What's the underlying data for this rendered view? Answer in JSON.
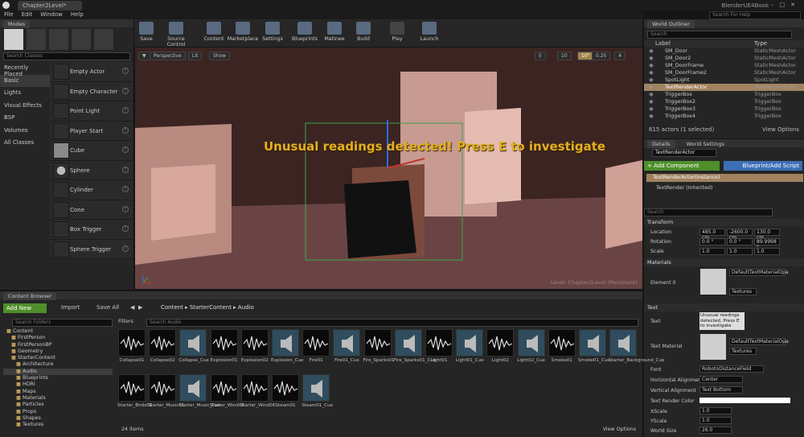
{
  "window": {
    "tab_title": "Chapter2Level*",
    "project_name": "BlenderUE4Book",
    "search_help_placeholder": "Search For Help"
  },
  "menu": [
    "File",
    "Edit",
    "Window",
    "Help"
  ],
  "modes": {
    "title": "Modes",
    "search_placeholder": "Search Classes",
    "categories": [
      "Recently Placed",
      "Basic",
      "Lights",
      "Visual Effects",
      "BSP",
      "Volumes",
      "All Classes"
    ],
    "selected_category": "Basic",
    "items": [
      "Empty Actor",
      "Empty Character",
      "Point Light",
      "Player Start",
      "Cube",
      "Sphere",
      "Cylinder",
      "Cone",
      "Box Trigger",
      "Sphere Trigger"
    ]
  },
  "toolbar": [
    "Save",
    "Source Control",
    "Content",
    "Marketplace",
    "Settings",
    "Blueprints",
    "Matinee",
    "Build",
    "Play",
    "Launch"
  ],
  "viewport": {
    "perspective": "Perspective",
    "lit": "Lit",
    "show": "Show",
    "grid_snap": "10",
    "rot_snap": "10°",
    "scale_snap": "0.25",
    "cam_speed": "4",
    "num5": "5",
    "text_render": "Unusual readings detected! Press E to investigate",
    "level_label": "Level:  Chapter2Level (Persistent)"
  },
  "outliner": {
    "title": "World Outliner",
    "search_placeholder": "Search",
    "col_label": "Label",
    "col_type": "Type",
    "rows": [
      {
        "label": "SM_Door",
        "type": "StaticMeshActor"
      },
      {
        "label": "SM_Door2",
        "type": "StaticMeshActor"
      },
      {
        "label": "SM_DoorFrame",
        "type": "StaticMeshActor"
      },
      {
        "label": "SM_DoorFrame2",
        "type": "StaticMeshActor"
      },
      {
        "label": "SpotLight",
        "type": "SpotLight"
      },
      {
        "label": "TextRenderActor",
        "type": "TextRenderActor"
      },
      {
        "label": "TriggerBox",
        "type": "TriggerBox"
      },
      {
        "label": "TriggerBox2",
        "type": "TriggerBox"
      },
      {
        "label": "TriggerBox3",
        "type": "TriggerBox"
      },
      {
        "label": "TriggerBox4",
        "type": "TriggerBox"
      }
    ],
    "selected_row": 5,
    "status": "615 actors (1 selected)",
    "view_options": "View Options"
  },
  "details": {
    "tab_details": "Details",
    "tab_world": "World Settings",
    "name": "TextRenderActor",
    "add_component": "+ Add Component",
    "blueprint_script": "Blueprint/Add Script",
    "instance": "TextRenderActor(Instance)",
    "inherited": "TextRender (Inherited)",
    "search_placeholder": "Search",
    "transform_header": "Transform",
    "location_label": "Location",
    "location": [
      "485.0 cm",
      "-2600.0 cm",
      "130.0 cm"
    ],
    "rotation_label": "Rotation",
    "rotation": [
      "0.0 °",
      "0.0 °",
      "89.9998 °"
    ],
    "scale_label": "Scale",
    "scale": [
      "1.0",
      "1.0",
      "1.0"
    ],
    "materials_header": "Materials",
    "element0": "Element 0",
    "material_name": "DefaultTextMaterialOpa",
    "textures_btn": "Textures",
    "text_header": "Text",
    "text_label": "Text",
    "text_value": "Unusual readings detected. Press E to investigate",
    "text_material_label": "Text Material",
    "text_material": "DefaultTextMaterialOpa",
    "text_material_btn": "Textures",
    "font_label": "Font",
    "font_value": "RobotoDistanceField",
    "h_align_label": "Horizontal Alignment",
    "h_align": "Center",
    "v_align_label": "Vertical Alignment",
    "v_align": "Text Bottom",
    "color_label": "Text Render Color",
    "xscale_label": "XScale",
    "xscale": "1.0",
    "yscale_label": "YScale",
    "yscale": "1.0",
    "world_size_label": "World Size",
    "world_size": "26.0"
  },
  "content_browser": {
    "title": "Content Browser",
    "add_new": "Add New",
    "import": "Import",
    "save_all": "Save All",
    "path": [
      "Content",
      "StarterContent",
      "Audio"
    ],
    "search_folders": "Search Folders",
    "filters": "Filters",
    "search_audio": "Search Audio",
    "folders": [
      {
        "name": "Content",
        "level": 0
      },
      {
        "name": "FirstPerson",
        "level": 1
      },
      {
        "name": "FirstPersonBP",
        "level": 1
      },
      {
        "name": "Geometry",
        "level": 1
      },
      {
        "name": "StarterContent",
        "level": 1
      },
      {
        "name": "Architecture",
        "level": 2
      },
      {
        "name": "Audio",
        "level": 2
      },
      {
        "name": "Blueprints",
        "level": 2
      },
      {
        "name": "HDRI",
        "level": 2
      },
      {
        "name": "Maps",
        "level": 2
      },
      {
        "name": "Materials",
        "level": 2
      },
      {
        "name": "Particles",
        "level": 2
      },
      {
        "name": "Props",
        "level": 2
      },
      {
        "name": "Shapes",
        "level": 2
      },
      {
        "name": "Textures",
        "level": 2
      }
    ],
    "selected_folder": 6,
    "assets": [
      "Collapse01",
      "Collapse02",
      "Collapse_Cue",
      "Explosion01",
      "Explosion02",
      "Explosion_Cue",
      "Fire01",
      "Fire01_Cue",
      "Fire_Sparks01",
      "Fire_Sparks01_Cue",
      "Light01",
      "Light01_Cue",
      "Light02",
      "Light02_Cue",
      "Smoke01",
      "Smoke01_Cue",
      "Starter_Background_Cue",
      "Starter_Birds01",
      "Starter_Music01",
      "Starter_Music_Cue",
      "Starter_Wind05",
      "Starter_Wind06",
      "Steam01",
      "Steam01_Cue"
    ],
    "cue_flags": [
      false,
      false,
      true,
      false,
      false,
      true,
      false,
      true,
      false,
      true,
      false,
      true,
      false,
      true,
      false,
      true,
      true,
      false,
      false,
      true,
      false,
      false,
      false,
      true
    ],
    "count": "24 items",
    "view_options": "View Options"
  }
}
